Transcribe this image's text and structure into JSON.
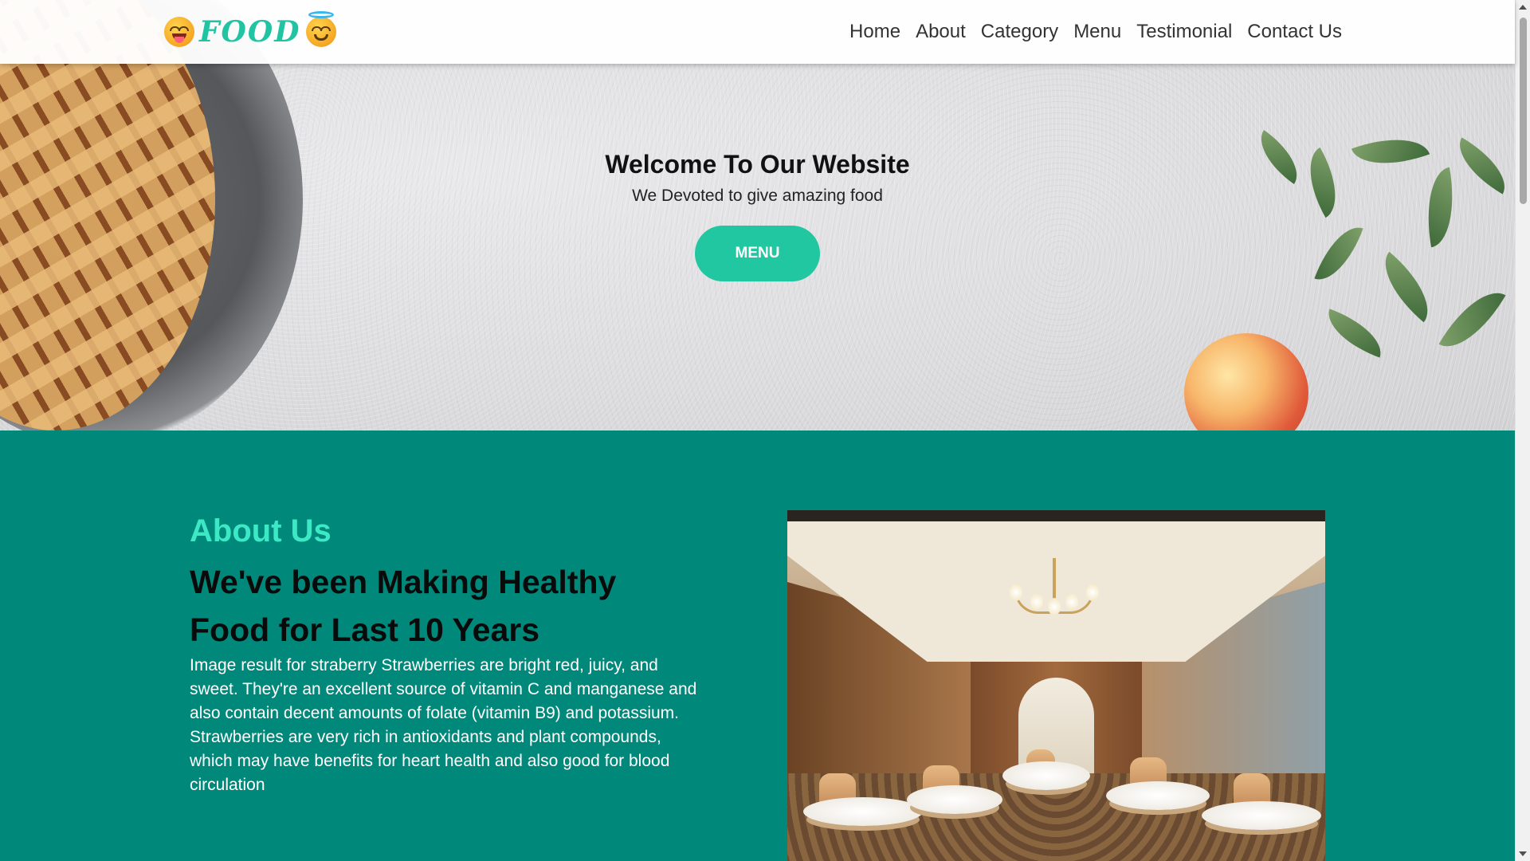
{
  "brand": {
    "logo_text": "FOOD",
    "left_icon": "face-savoring-food-emoji",
    "right_icon": "smiling-face-with-halo-emoji",
    "accent_color": "#20c4a3"
  },
  "nav": {
    "items": [
      {
        "label": "Home"
      },
      {
        "label": "About"
      },
      {
        "label": "Category"
      },
      {
        "label": "Menu"
      },
      {
        "label": "Testimonial"
      },
      {
        "label": "Contact Us"
      }
    ]
  },
  "hero": {
    "title": "Welcome To Our Website",
    "subtitle": "We Devoted to give amazing food",
    "button_label": "MENU",
    "button_color": "#21c7a0"
  },
  "about": {
    "label": "About Us",
    "heading": "We've been Making Healthy Food for Last 10 Years",
    "body": "Image result for straberry Strawberries are bright red, juicy, and sweet. They're an excellent source of vitamin C and manganese and also contain decent amounts of folate (vitamin B9) and potassium. Strawberries are very rich in antioxidants and plant compounds, which may have benefits for heart health and also good for blood circulation",
    "background_color": "#00897b",
    "label_color": "#3de8c4"
  }
}
